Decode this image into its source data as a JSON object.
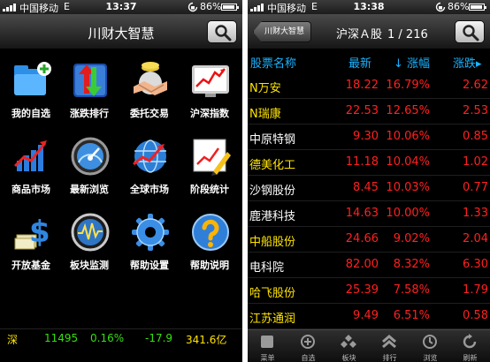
{
  "left": {
    "status": {
      "carrier": "中国移动",
      "network": "E",
      "time": "13:37",
      "battery": "86%"
    },
    "title": "川财大智慧",
    "tiles": [
      {
        "label": "我的自选",
        "icon": "folder-plus-icon"
      },
      {
        "label": "涨跌排行",
        "icon": "up-down-arrows-icon"
      },
      {
        "label": "委托交易",
        "icon": "handshake-coins-icon"
      },
      {
        "label": "沪深指数",
        "icon": "index-chart-icon"
      },
      {
        "label": "商品市场",
        "icon": "bar-growth-icon"
      },
      {
        "label": "最新浏览",
        "icon": "speedometer-icon"
      },
      {
        "label": "全球市场",
        "icon": "globe-chart-icon"
      },
      {
        "label": "阶段统计",
        "icon": "pencil-chart-icon"
      },
      {
        "label": "开放基金",
        "icon": "dollar-cash-icon"
      },
      {
        "label": "板块监测",
        "icon": "monitor-wave-icon"
      },
      {
        "label": "帮助设置",
        "icon": "gear-icon"
      },
      {
        "label": "帮助说明",
        "icon": "question-icon"
      }
    ],
    "ticker": {
      "market": "深",
      "index": "11495",
      "change_pct": "0.16%",
      "change": "-17.9",
      "volume": "341.6亿"
    }
  },
  "right": {
    "status": {
      "carrier": "中国移动",
      "network": "E",
      "time": "13:38",
      "battery": "86%"
    },
    "back_label": "川财大智慧",
    "title": "沪深Ａ股",
    "page": "1 / 216",
    "headers": {
      "name": "股票名称",
      "price": "最新",
      "change_pct": "↓ 涨幅",
      "change": "涨跌▸"
    },
    "rows": [
      {
        "name": "N万安",
        "price": "18.22",
        "pct": "16.79%",
        "chg": "2.62",
        "name_color": "#ffe400"
      },
      {
        "name": "N瑞康",
        "price": "22.53",
        "pct": "12.65%",
        "chg": "2.53",
        "name_color": "#ffe400"
      },
      {
        "name": "中原特钢",
        "price": "9.30",
        "pct": "10.06%",
        "chg": "0.85",
        "name_color": "#ffffff"
      },
      {
        "name": "德美化工",
        "price": "11.18",
        "pct": "10.04%",
        "chg": "1.02",
        "name_color": "#ffe400"
      },
      {
        "name": "沙钢股份",
        "price": "8.45",
        "pct": "10.03%",
        "chg": "0.77",
        "name_color": "#ffffff"
      },
      {
        "name": "鹿港科技",
        "price": "14.63",
        "pct": "10.00%",
        "chg": "1.33",
        "name_color": "#ffffff"
      },
      {
        "name": "中船股份",
        "price": "24.66",
        "pct": "9.02%",
        "chg": "2.04",
        "name_color": "#ffe400"
      },
      {
        "name": "电科院",
        "price": "82.00",
        "pct": "8.32%",
        "chg": "6.30",
        "name_color": "#ffffff"
      },
      {
        "name": "哈飞股份",
        "price": "25.39",
        "pct": "7.58%",
        "chg": "1.79",
        "name_color": "#ffe400"
      },
      {
        "name": "江苏通润",
        "price": "9.49",
        "pct": "6.51%",
        "chg": "0.58",
        "name_color": "#ffe400"
      }
    ],
    "tabs": [
      {
        "label": "菜单",
        "icon": "menu-square-icon"
      },
      {
        "label": "自选",
        "icon": "add-circle-icon"
      },
      {
        "label": "板块",
        "icon": "blocks-icon"
      },
      {
        "label": "排行",
        "icon": "rank-chevrons-icon"
      },
      {
        "label": "浏览",
        "icon": "clock-icon"
      },
      {
        "label": "刷新",
        "icon": "refresh-icon"
      }
    ]
  },
  "colors": {
    "up": "#ff2020",
    "down": "#36e010",
    "header": "#19b3ff",
    "highlight": "#ffe400"
  }
}
